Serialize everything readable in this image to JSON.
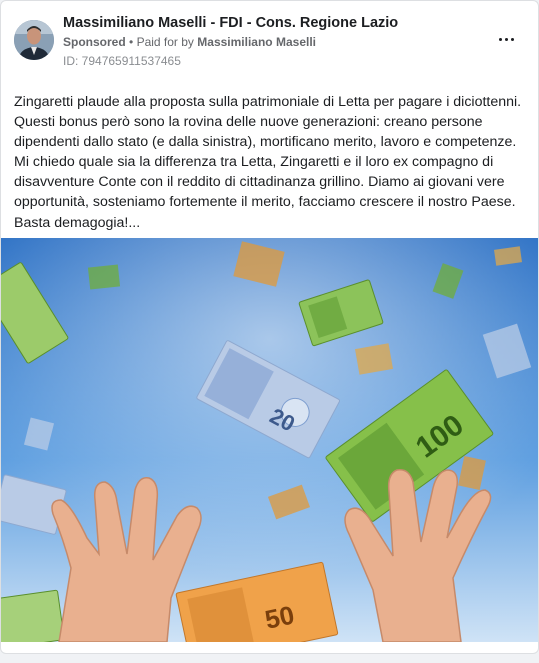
{
  "post": {
    "page_name": "Massimiliano Maselli - FDI - Cons. Regione Lazio",
    "sponsored_label": "Sponsored",
    "separator": "•",
    "paid_for_prefix": "Paid for by",
    "paid_for_name": "Massimiliano Maselli",
    "ad_id": "ID: 794765911537465",
    "more_icon": "more-horizontal-icon",
    "body_lines": [
      "Zingaretti plaude alla proposta sulla patrimoniale di Letta per pagare i diciottenni.",
      "Questi bonus però sono la rovina delle nuove generazioni: creano persone",
      "dipendenti dallo stato (e dalla sinistra), mortificano merito, lavoro e competenze.",
      "Mi chiedo quale sia la differenza tra Letta, Zingaretti e il loro ex compagno di",
      "disavventure Conte con il reddito di cittadinanza grillino. Diamo ai giovani vere",
      "opportunità, sosteniamo fortemente il merito, facciamo crescere il nostro Paese.",
      "Basta demagogia!..."
    ],
    "media": {
      "banknote_labels": [
        "20",
        "50",
        "100"
      ]
    }
  },
  "colors": {
    "sky_top": "#2a6fc4",
    "sky_bottom": "#cfe3f6",
    "note_green": "#6fae3a",
    "note_blue": "#b9cbe6",
    "note_orange": "#e09a3a",
    "skin": "#e9b08f"
  }
}
